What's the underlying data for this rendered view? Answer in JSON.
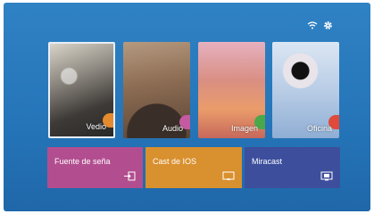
{
  "tiles": [
    {
      "label": "Vedio",
      "accent": "#e58a2e"
    },
    {
      "label": "Audio",
      "accent": "#c45aa0"
    },
    {
      "label": "Imagen",
      "accent": "#4aa84a"
    },
    {
      "label": "Oficina",
      "accent": "#e04a3a"
    }
  ],
  "bars": [
    {
      "label": "Fuente de seña",
      "icon": "input-source-icon",
      "color": "#b24e8f"
    },
    {
      "label": "Cast de IOS",
      "icon": "cast-icon",
      "color": "#d9902e"
    },
    {
      "label": "Miracast",
      "icon": "screen-mirror-icon",
      "color": "#3c4e9c"
    }
  ],
  "status_icons": [
    "wifi-icon",
    "gear-icon"
  ]
}
